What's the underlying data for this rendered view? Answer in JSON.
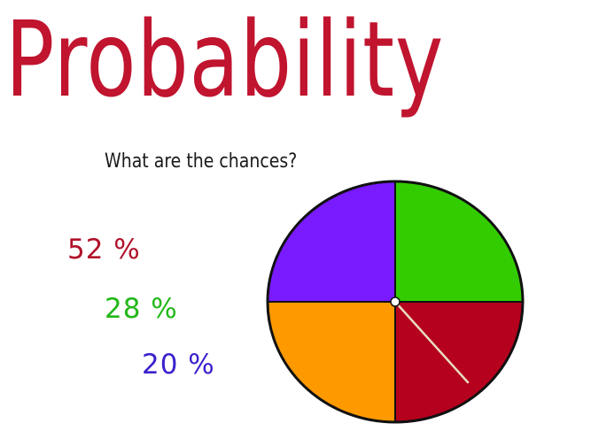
{
  "title": "Probability",
  "subtitle": "What are the chances?",
  "percentages": [
    {
      "label": "52 %",
      "color": "#b0122b"
    },
    {
      "label": "28 %",
      "color": "#22b818"
    },
    {
      "label": "20 %",
      "color": "#3a22cc"
    }
  ],
  "colors": {
    "title": "#c0142f",
    "sector_green": "#33cc00",
    "sector_red": "#b5001e",
    "sector_orange": "#ff9900",
    "sector_purple": "#7a1aff",
    "outline": "#111111",
    "pointer": "#e8dcc0"
  },
  "spinner": {
    "sectors": [
      {
        "name": "green",
        "color": "#33cc00",
        "fraction": 0.25
      },
      {
        "name": "red",
        "color": "#b5001e",
        "fraction": 0.25
      },
      {
        "name": "orange",
        "color": "#ff9900",
        "fraction": 0.25
      },
      {
        "name": "purple",
        "color": "#7a1aff",
        "fraction": 0.25
      }
    ],
    "pointer_icon": "spinner-arrow-icon"
  }
}
